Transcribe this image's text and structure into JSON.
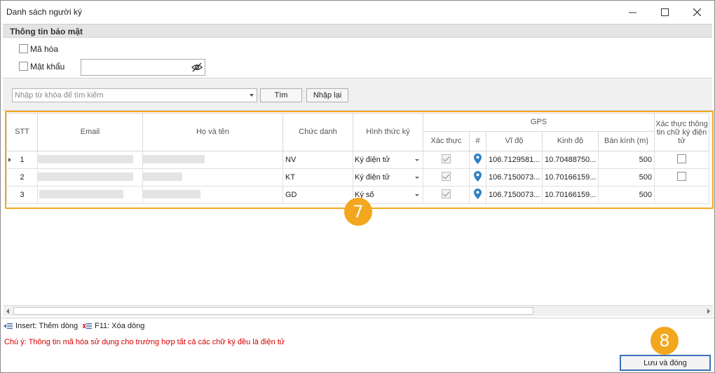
{
  "window": {
    "title": "Danh sách người ký"
  },
  "security": {
    "header": "Thông tin bảo mật",
    "encrypt_label": "Mã hóa",
    "password_label": "Mật khẩu",
    "password_value": ""
  },
  "search": {
    "placeholder": "Nhập từ khóa để tìm kiếm",
    "find_label": "Tìm",
    "reset_label": "Nhập lại"
  },
  "grid": {
    "headers": {
      "stt": "STT",
      "email": "Email",
      "name": "Họ và tên",
      "title": "Chức danh",
      "method": "Hình thức ký",
      "gps": "GPS",
      "verify": "Xác thực",
      "hash": "#",
      "lat": "Vĩ độ",
      "lng": "Kinh độ",
      "radius": "Bán kính (m)",
      "verify_info": "Xác thực thông tin chữ ký điện tử"
    },
    "rows": [
      {
        "stt": "1",
        "title": "NV",
        "method": "Ký điện tử",
        "lat": "106.7129581...",
        "lng": "10.70488750...",
        "radius": "500"
      },
      {
        "stt": "2",
        "title": "KT",
        "method": "Ký điện tử",
        "lat": "106.7150073...",
        "lng": "10.70166159...",
        "radius": "500"
      },
      {
        "stt": "3",
        "title": "GD",
        "method": "Ký số",
        "lat": "106.7150073...",
        "lng": "10.70166159...",
        "radius": "500"
      }
    ]
  },
  "footer": {
    "insert_hint": "Insert: Thêm dòng",
    "delete_hint": "F11: Xóa dòng",
    "note": "Chú ý: Thông tin mã hóa sử dụng cho trường hợp tất cả các chữ ký đều là điện tử",
    "save_label": "Lưu và đóng"
  },
  "annotations": {
    "step7": "7",
    "step8": "8"
  },
  "colors": {
    "highlight": "#f2a71e",
    "note": "#d40000",
    "pin": "#2f7fc1",
    "primary_border": "#3d6fb6"
  }
}
